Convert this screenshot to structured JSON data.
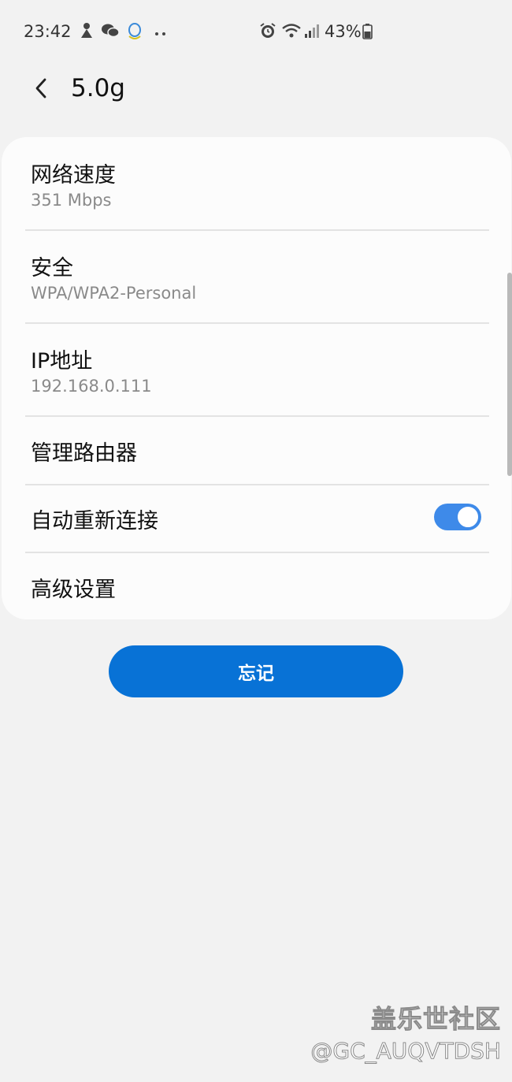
{
  "status_bar": {
    "time": "23:42",
    "battery": "43%",
    "left_icons": [
      "app-icon",
      "wechat-icon",
      "qq-icon",
      "more-dots-icon"
    ],
    "right_icons": [
      "alarm-icon",
      "wifi-icon",
      "signal-icon",
      "battery-icon"
    ]
  },
  "header": {
    "back_icon": "chevron-left-icon",
    "title": "5.0g"
  },
  "details": {
    "speed": {
      "label": "网络速度",
      "value": "351 Mbps"
    },
    "security": {
      "label": "安全",
      "value": "WPA/WPA2-Personal"
    },
    "ip": {
      "label": "IP地址",
      "value": "192.168.0.111"
    },
    "manage_router": {
      "label": "管理路由器"
    },
    "auto_reconnect": {
      "label": "自动重新连接",
      "enabled": true
    },
    "advanced": {
      "label": "高级设置"
    }
  },
  "forget_button": {
    "label": "忘记"
  },
  "watermark": {
    "title": "盖乐世社区",
    "handle": "@GC_AUQVTDSH"
  },
  "colors": {
    "accent": "#0872d6",
    "toggle_on": "#3e8ae9",
    "background": "#f2f2f2"
  }
}
